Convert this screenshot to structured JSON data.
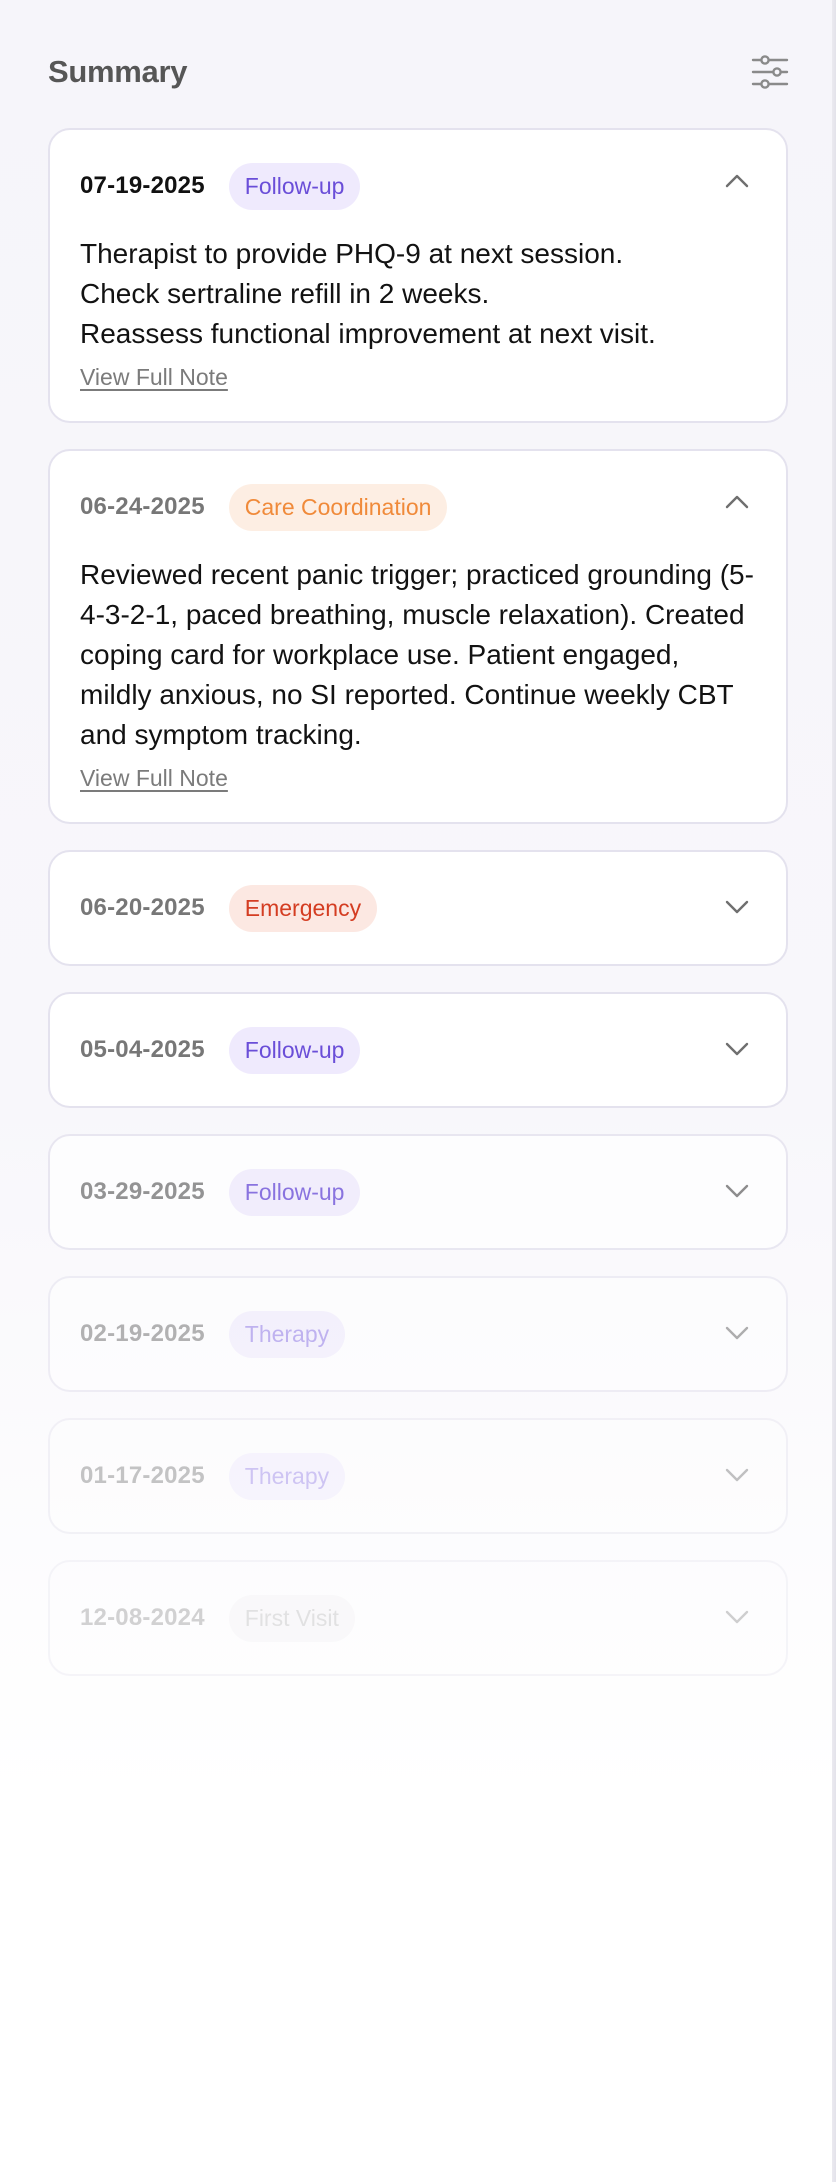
{
  "header": {
    "title": "Summary"
  },
  "entries": [
    {
      "date": "07-19-2025",
      "tag": "Follow-up",
      "expanded": true,
      "lines": [
        "Therapist to provide PHQ-9 at next session.",
        "Check sertraline refill in 2 weeks.",
        "Reassess functional improvement at next visit."
      ],
      "link": "View Full Note"
    },
    {
      "date": "06-24-2025",
      "tag": "Care Coordination",
      "expanded": true,
      "paragraph": "Reviewed recent panic trigger; practiced grounding (5-4-3-2-1, paced breathing, muscle relaxation). Created coping card for workplace use. Patient engaged, mildly anxious, no SI reported. Continue weekly CBT and symptom tracking.",
      "link": "View Full Note"
    },
    {
      "date": "06-20-2025",
      "tag": "Emergency",
      "expanded": false
    },
    {
      "date": "05-04-2025",
      "tag": "Follow-up",
      "expanded": false
    },
    {
      "date": "03-29-2025",
      "tag": "Follow-up",
      "expanded": false
    },
    {
      "date": "02-19-2025",
      "tag": "Therapy",
      "expanded": false
    },
    {
      "date": "01-17-2025",
      "tag": "Therapy",
      "expanded": false
    },
    {
      "date": "12-08-2024",
      "tag": "First Visit",
      "expanded": false
    }
  ],
  "colors": {
    "follow_up": "#6a4ed8",
    "care_coordination": "#f08a3a",
    "emergency": "#d43d22",
    "therapy": "#8f79e6",
    "first_visit": "#a8a8a8"
  },
  "icons": {
    "filter": "sliders-icon",
    "expand": "chevron-down-icon",
    "collapse": "chevron-up-icon"
  }
}
